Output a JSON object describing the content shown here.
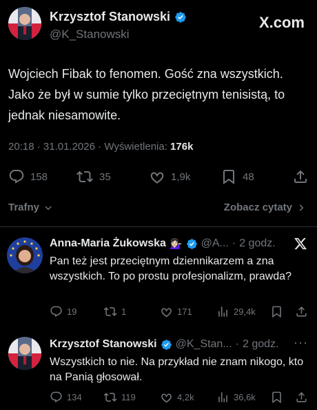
{
  "main_post": {
    "author_name": "Krzysztof Stanowski",
    "handle": "@K_Stanowski",
    "brand": "X.com",
    "text": "Wojciech Fibak to fenomen. Gość zna wszystkich. Jako że był w sumie tylko przeciętnym tenisistą, to jednak niesamowite.",
    "time": "20:18",
    "date": "31.01.2026",
    "views_label": "Wyświetlenia:",
    "views": "176k",
    "replies": "158",
    "reposts": "35",
    "likes": "1,9k",
    "bookmarks": "48"
  },
  "sort": {
    "label": "Trafny",
    "quotes_label": "Zobacz cytaty"
  },
  "replies": [
    {
      "author_name": "Anna-Maria Żukowska",
      "emoji": "💁🏻‍♀️",
      "handle": "@A...",
      "time": "2 godz.",
      "text": "Pan też jest przeciętnym dziennikarzem a zna wszystkich. To po prostu profesjonalizm, prawda?",
      "replies": "19",
      "reposts": "1",
      "likes": "171",
      "views": "29,4k"
    },
    {
      "author_name": "Krzysztof Stanowski",
      "handle": "@K_Stan...",
      "time": "2 godz.",
      "text": "Wszystkich to nie. Na przykład nie znam nikogo, kto na Panią głosował.",
      "replies": "134",
      "reposts": "119",
      "likes": "4,2k",
      "views": "36,6k"
    }
  ],
  "colors": {
    "background": "#000000",
    "text": "#e7e9ea",
    "muted": "#71767b",
    "verified": "#1d9bf0",
    "divider": "#2f3336"
  }
}
